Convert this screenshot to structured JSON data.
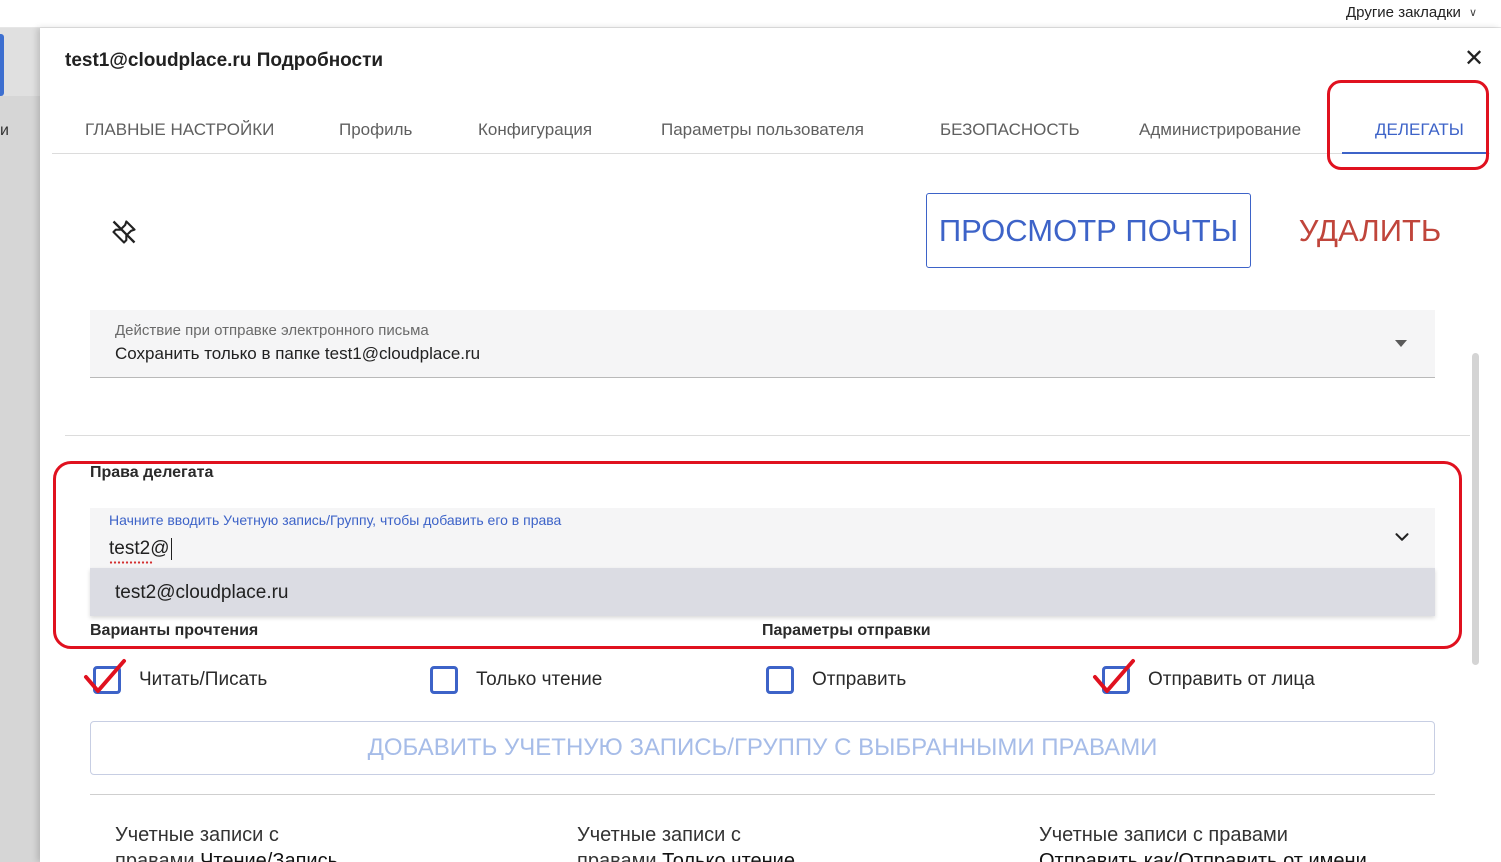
{
  "browser": {
    "other_bookmarks": "Другие закладки"
  },
  "backdrop": {
    "fragment": "и"
  },
  "dialog": {
    "title": "test1@cloudplace.ru Подробности",
    "close_glyph": "✕"
  },
  "tabs": [
    {
      "label": "ГЛАВНЫЕ НАСТРОЙКИ",
      "active": false
    },
    {
      "label": "Профиль",
      "active": false
    },
    {
      "label": "Конфигурация",
      "active": false
    },
    {
      "label": "Параметры пользователя",
      "active": false
    },
    {
      "label": "БЕЗОПАСНОСТЬ",
      "active": false
    },
    {
      "label": "Администрирование",
      "active": false
    },
    {
      "label": "ДЕЛЕГАТЫ",
      "active": true
    }
  ],
  "toolbar": {
    "view_mail_label": "ПРОСМОТР ПОЧТЫ",
    "delete_label": "УДАЛИТЬ"
  },
  "send_action": {
    "label": "Действие при отправке электронного письма",
    "value": "Сохранить только в папке test1@cloudplace.ru"
  },
  "delegate_rights": {
    "title": "Права делегата",
    "combo_label": "Начните вводить Учетную запись/Группу, чтобы добавить его в права",
    "combo_value": "test2@",
    "suggestion": "test2@cloudplace.ru"
  },
  "read_options": {
    "title": "Варианты прочтения",
    "items": [
      {
        "label": "Читать/Писать",
        "checked": true
      },
      {
        "label": "Только чтение",
        "checked": false
      }
    ]
  },
  "send_options": {
    "title": "Параметры отправки",
    "items": [
      {
        "label": "Отправить",
        "checked": false
      },
      {
        "label": "Отправить от лица",
        "checked": true
      }
    ]
  },
  "add_button_label": "ДОБАВИТЬ УЧЕТНУЮ ЗАПИСЬ/ГРУППУ С ВЫБРАННЫМИ ПРАВАМИ",
  "columns": [
    {
      "prefix": "Учетные записи с",
      "line2_prefix": "правами ",
      "emphasis": "Чтение/Запись"
    },
    {
      "prefix": "Учетные записи с",
      "line2_prefix": "правами ",
      "emphasis": "Только чтение"
    },
    {
      "prefix": "Учетные записи с правами",
      "line2_prefix": "",
      "emphasis": "Отправить как/Отправить от имени"
    }
  ],
  "colors": {
    "accent": "#3d63c8",
    "delete": "#c0453b",
    "annotation": "#e0111f",
    "checkmark": "#e0111f"
  }
}
